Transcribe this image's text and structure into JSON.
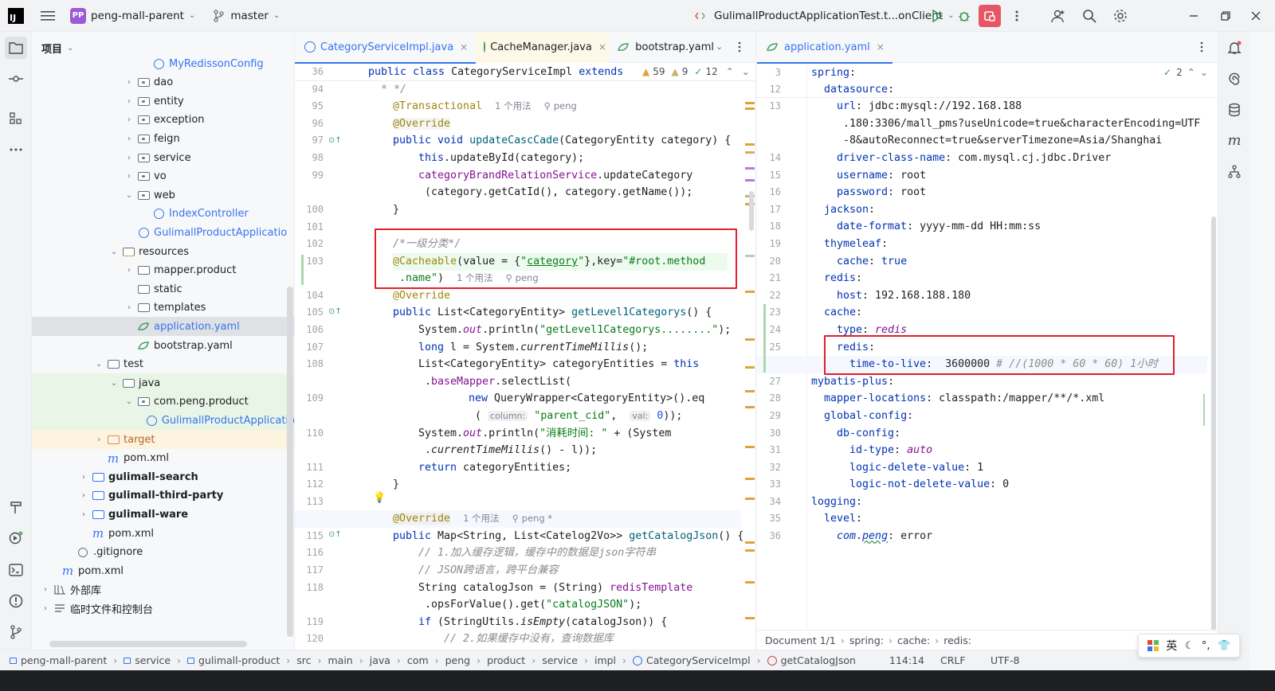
{
  "topbar": {
    "project_badge": "PP",
    "project": "peng-mall-parent",
    "branch": "master",
    "run_config": "GulimallProductApplicationTest.t...onClient"
  },
  "project_panel": {
    "title": "项目",
    "tree": [
      {
        "label": "MyRedissonConfig",
        "indent": 4,
        "type": "class",
        "arrow": ""
      },
      {
        "label": "dao",
        "indent": 3,
        "type": "pkg",
        "arrow": "›"
      },
      {
        "label": "entity",
        "indent": 3,
        "type": "pkg",
        "arrow": "›"
      },
      {
        "label": "exception",
        "indent": 3,
        "type": "pkg",
        "arrow": "›"
      },
      {
        "label": "feign",
        "indent": 3,
        "type": "pkg",
        "arrow": "›"
      },
      {
        "label": "service",
        "indent": 3,
        "type": "pkg",
        "arrow": "›"
      },
      {
        "label": "vo",
        "indent": 3,
        "type": "pkg",
        "arrow": "›"
      },
      {
        "label": "web",
        "indent": 3,
        "type": "pkg",
        "arrow": "⌄"
      },
      {
        "label": "IndexController",
        "indent": 4,
        "type": "class",
        "arrow": ""
      },
      {
        "label": "GulimallProductApplicatio",
        "indent": 3,
        "type": "class",
        "arrow": ""
      },
      {
        "label": "resources",
        "indent": 2,
        "type": "res",
        "arrow": "⌄"
      },
      {
        "label": "mapper.product",
        "indent": 3,
        "type": "folder",
        "arrow": "›"
      },
      {
        "label": "static",
        "indent": 3,
        "type": "folder",
        "arrow": ""
      },
      {
        "label": "templates",
        "indent": 3,
        "type": "folder",
        "arrow": "›"
      },
      {
        "label": "application.yaml",
        "indent": 3,
        "type": "yaml",
        "arrow": "",
        "selected": true
      },
      {
        "label": "bootstrap.yaml",
        "indent": 3,
        "type": "yaml",
        "arrow": ""
      },
      {
        "label": "test",
        "indent": 1,
        "type": "folder",
        "arrow": "⌄"
      },
      {
        "label": "java",
        "indent": 2,
        "type": "folder",
        "arrow": "⌄",
        "green": true
      },
      {
        "label": "com.peng.product",
        "indent": 3,
        "type": "pkg",
        "arrow": "⌄",
        "green": true
      },
      {
        "label": "GulimallProductApplicatio",
        "indent": 4,
        "type": "class",
        "arrow": "",
        "green": true
      },
      {
        "label": "target",
        "indent": 1,
        "type": "orange",
        "arrow": "›",
        "orange": true
      },
      {
        "label": "pom.xml",
        "indent": 1,
        "type": "maven",
        "arrow": ""
      },
      {
        "label": "gulimall-search",
        "indent": 0,
        "type": "module",
        "arrow": "›",
        "bold": true
      },
      {
        "label": "gulimall-third-party",
        "indent": 0,
        "type": "module",
        "arrow": "›",
        "bold": true
      },
      {
        "label": "gulimall-ware",
        "indent": 0,
        "type": "module",
        "arrow": "›",
        "bold": true
      },
      {
        "label": "pom.xml",
        "indent": 0,
        "type": "maven",
        "arrow": ""
      },
      {
        "label": ".gitignore",
        "indent": -1,
        "type": "ignore",
        "arrow": ""
      },
      {
        "label": "pom.xml",
        "indent": -2,
        "type": "maven",
        "arrow": ""
      },
      {
        "label": "外部库",
        "indent": -3,
        "type": "lib",
        "arrow": "›"
      },
      {
        "label": "临时文件和控制台",
        "indent": -3,
        "type": "scratch",
        "arrow": "›"
      }
    ]
  },
  "editor_left": {
    "tabs": [
      {
        "label": "CategoryServiceImpl.java",
        "active": true,
        "close": "×"
      },
      {
        "label": "CacheManager.java",
        "active": false,
        "close": "×"
      },
      {
        "label": "bootstrap.yaml",
        "active": false,
        "close": ""
      }
    ],
    "sticky_line": "36",
    "sticky_code": "public class CategoryServiceImpl extends",
    "warnings": "59",
    "weak_warnings": "9",
    "checks": "12",
    "hint_usage": "1 个用法",
    "hint_author": "peng",
    "hint_author2": "peng *",
    "hint_column": "column:",
    "hint_val": "val:",
    "line_numbers": [
      "94",
      "95",
      "96",
      "97",
      "98",
      "99",
      "",
      "100",
      "101",
      "102",
      "103",
      "",
      "104",
      "105",
      "106",
      "107",
      "108",
      "",
      "109",
      "",
      "110",
      "",
      "111",
      "112",
      "113",
      "114",
      "115",
      "116",
      "117",
      "118",
      "",
      "119",
      "120"
    ]
  },
  "editor_right": {
    "tabs": [
      {
        "label": "application.yaml",
        "active": true,
        "close": "×"
      }
    ],
    "checks": "2",
    "line_numbers": [
      "3",
      "12",
      "13",
      "",
      "",
      "14",
      "15",
      "16",
      "17",
      "18",
      "19",
      "20",
      "21",
      "22",
      "23",
      "24",
      "25",
      "26",
      "27",
      "28",
      "29",
      "30",
      "31",
      "32",
      "33",
      "34",
      "35",
      "36"
    ],
    "yaml": {
      "url": "jdbc:mysql://192.168.188",
      "url2": ".180:3306/mall_pms?useUnicode=true&characterEncoding=UTF",
      "url3": "-8&autoReconnect=true&serverTimezone=Asia/Shanghai",
      "driver": "com.mysql.cj.jdbc.Driver",
      "username": "root",
      "password": "root",
      "date_format": "yyyy-mm-dd HH:mm:ss",
      "cache_flag": "true",
      "redis_host": "192.168.188.180",
      "cache_type": "redis",
      "ttl": "3600000",
      "ttl_comment": "# //(1000 * 60 * 60) 1小时",
      "mapper_locations": "classpath:/mapper/**/*.xml",
      "id_type": "auto",
      "logic_delete": "1",
      "logic_not_delete": "0",
      "log_pkg": "com.peng",
      "log_level": "error"
    },
    "breadcrumb": [
      "Document 1/1",
      "spring:",
      "cache:",
      "redis:"
    ]
  },
  "status": {
    "crumbs": [
      "peng-mall-parent",
      "service",
      "gulimall-product",
      "src",
      "main",
      "java",
      "com",
      "peng",
      "product",
      "service",
      "impl",
      "CategoryServiceImpl",
      "getCatalogJson"
    ],
    "position": "114:14",
    "line_sep": "CRLF",
    "encoding": "UTF-8"
  },
  "ime": {
    "lang": "英"
  }
}
